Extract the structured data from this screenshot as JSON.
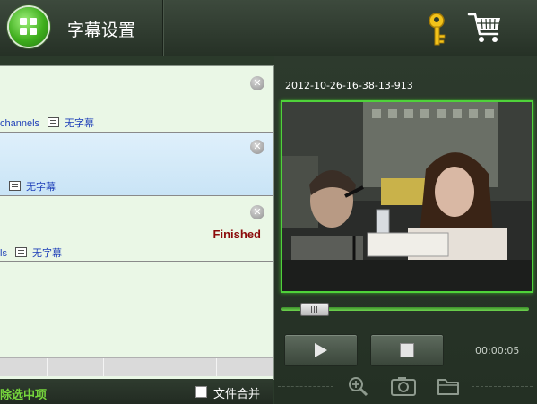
{
  "header": {
    "title": "字幕设置"
  },
  "list": {
    "items": [
      {
        "meta_prefix": "channels",
        "subtitle_label": "无字幕",
        "status": ""
      },
      {
        "meta_prefix": "",
        "subtitle_label": "无字幕",
        "status": ""
      },
      {
        "meta_prefix": "ls",
        "subtitle_label": "无字幕",
        "status": "Finished"
      }
    ]
  },
  "bottom": {
    "delete_selected_label": "除选中项",
    "merge_files_label": "文件合并"
  },
  "preview": {
    "timestamp": "2012-10-26-16-38-13-913",
    "current_time": "00:00:05",
    "seek_position": 0.13
  },
  "colors": {
    "accent_green": "#4fd23a",
    "finished_status": "#8b0a0a",
    "link_blue": "#1e3fb8"
  }
}
